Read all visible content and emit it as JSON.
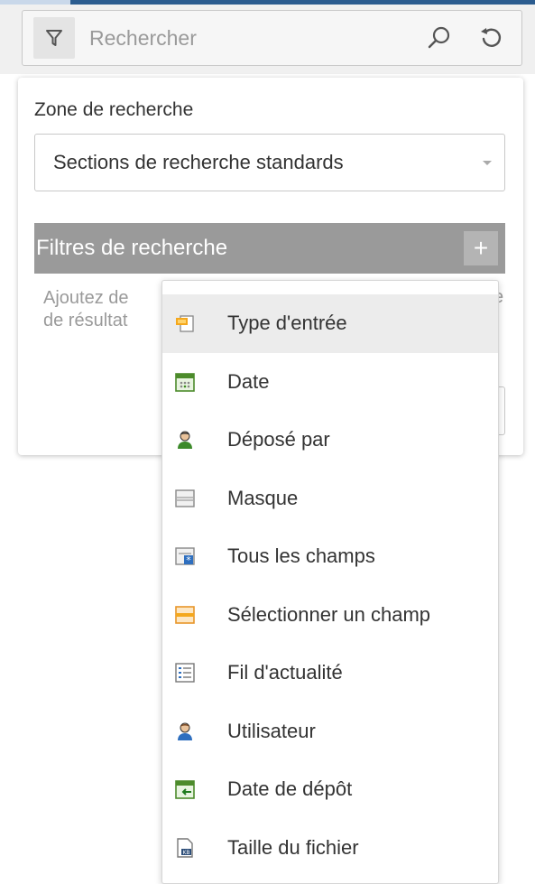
{
  "search": {
    "placeholder": "Rechercher"
  },
  "panel": {
    "zone_label": "Zone de recherche",
    "zone_value": "Sections de recherche standards",
    "filters_title": "Filtres de recherche",
    "add_symbol": "+",
    "hint_line1": "Ajoutez de",
    "hint_line2": "de résultat",
    "hint_overflow": "e"
  },
  "menu": {
    "items": [
      {
        "label": "Type d'entrée",
        "icon": "entry-type-icon",
        "highlighted": true
      },
      {
        "label": "Date",
        "icon": "calendar-icon"
      },
      {
        "label": "Déposé par",
        "icon": "user-green-icon"
      },
      {
        "label": "Masque",
        "icon": "mask-icon"
      },
      {
        "label": "Tous les champs",
        "icon": "all-fields-icon"
      },
      {
        "label": "Sélectionner un champ",
        "icon": "select-field-icon"
      },
      {
        "label": "Fil d'actualité",
        "icon": "news-feed-icon"
      },
      {
        "label": "Utilisateur",
        "icon": "user-blue-icon"
      },
      {
        "label": "Date de dépôt",
        "icon": "deposit-date-icon"
      },
      {
        "label": "Taille du fichier",
        "icon": "file-size-icon"
      }
    ]
  },
  "colors": {
    "top_accent": "#2b5c8f",
    "filters_header_bg": "#9a9a9a",
    "highlight_bg": "#ececec"
  }
}
